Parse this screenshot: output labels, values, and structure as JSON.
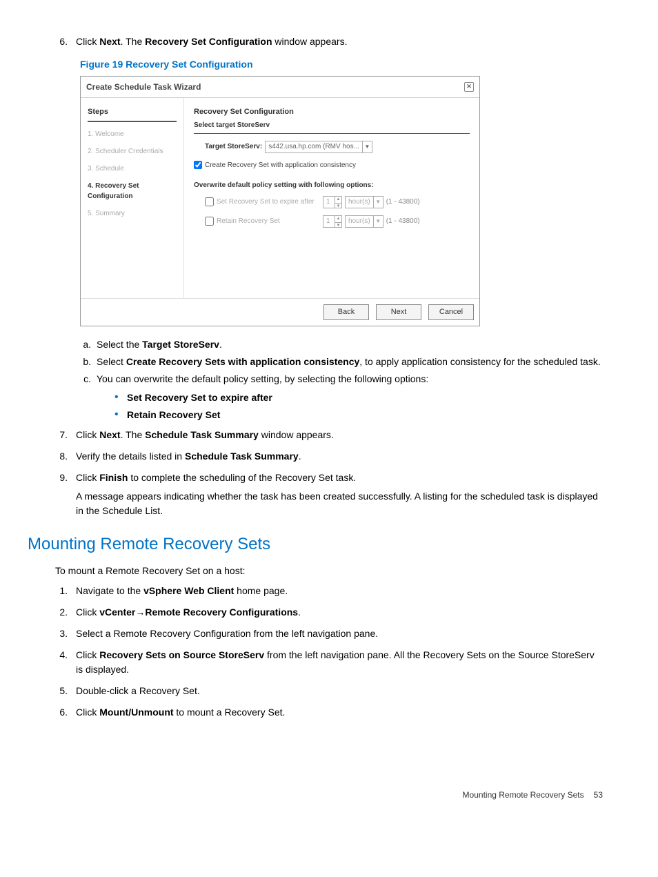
{
  "step6": {
    "num": "6.",
    "prefix": "Click ",
    "next": "Next",
    "mid": ". The ",
    "win": "Recovery Set Configuration",
    "suffix": " window appears."
  },
  "figure": {
    "caption": "Figure 19 Recovery Set Configuration"
  },
  "wizard": {
    "title": "Create Schedule Task Wizard",
    "steps_header": "Steps",
    "steps": [
      "1. Welcome",
      "2. Scheduler Credentials",
      "3. Schedule",
      "4. Recovery Set Configuration",
      "5. Summary"
    ],
    "main_title": "Recovery Set Configuration",
    "select_target": "Select target StoreServ",
    "target_label": "Target StoreServ:",
    "target_value": "s442.usa.hp.com (RMV hos...",
    "create_consistency": "Create Recovery Set with application consistency",
    "overwrite_header": "Overwrite default policy setting with following options:",
    "expire_label": "Set Recovery Set to expire after",
    "expire_value": "1",
    "expire_unit": "hour(s)",
    "expire_range": "(1 - 43800)",
    "retain_label": "Retain Recovery Set",
    "retain_value": "1",
    "retain_unit": "hour(s)",
    "retain_range": "(1 - 43800)",
    "back": "Back",
    "next": "Next",
    "cancel": "Cancel"
  },
  "sub_a": {
    "mark": "a.",
    "prefix": "Select the ",
    "bold": "Target StoreServ",
    "suffix": "."
  },
  "sub_b": {
    "mark": "b.",
    "prefix": "Select ",
    "bold": "Create Recovery Sets with application consistency",
    "suffix": ", to apply application consistency for the scheduled task."
  },
  "sub_c": {
    "mark": "c.",
    "text": "You can overwrite the default policy setting, by selecting the following options:"
  },
  "bullet1": "Set Recovery Set to expire after",
  "bullet2": "Retain Recovery Set",
  "step7": {
    "num": "7.",
    "prefix": "Click ",
    "next": "Next",
    "mid": ". The ",
    "win": "Schedule Task Summary",
    "suffix": " window appears."
  },
  "step8": {
    "num": "8.",
    "prefix": "Verify the details listed in ",
    "bold": "Schedule Task Summary",
    "suffix": "."
  },
  "step9": {
    "num": "9.",
    "prefix": "Click ",
    "bold": "Finish",
    "suffix": " to complete the scheduling of the Recovery Set task."
  },
  "step9_extra": "A message appears indicating whether the task has been created successfully. A listing for the scheduled task is displayed in the Schedule List.",
  "section": "Mounting Remote Recovery Sets",
  "mount_intro": "To mount a Remote Recovery Set on a host:",
  "m1": {
    "num": "1.",
    "prefix": "Navigate to the ",
    "bold": "vSphere Web Client",
    "suffix": " home page."
  },
  "m2": {
    "num": "2.",
    "prefix": "Click ",
    "bold1": "vCenter",
    "arrow": "→",
    "bold2": "Remote Recovery Configurations",
    "suffix": "."
  },
  "m3": {
    "num": "3.",
    "text": "Select a Remote Recovery Configuration from the left navigation pane."
  },
  "m4": {
    "num": "4.",
    "prefix": "Click ",
    "bold": "Recovery Sets on Source StoreServ",
    "suffix": " from the left navigation pane. All the Recovery Sets on the Source StoreServ is displayed."
  },
  "m5": {
    "num": "5.",
    "text": "Double-click a Recovery Set."
  },
  "m6": {
    "num": "6.",
    "prefix": "Click ",
    "bold": "Mount/Unmount",
    "suffix": " to mount a Recovery Set."
  },
  "footer_left": "Mounting Remote Recovery Sets",
  "footer_right": "53"
}
